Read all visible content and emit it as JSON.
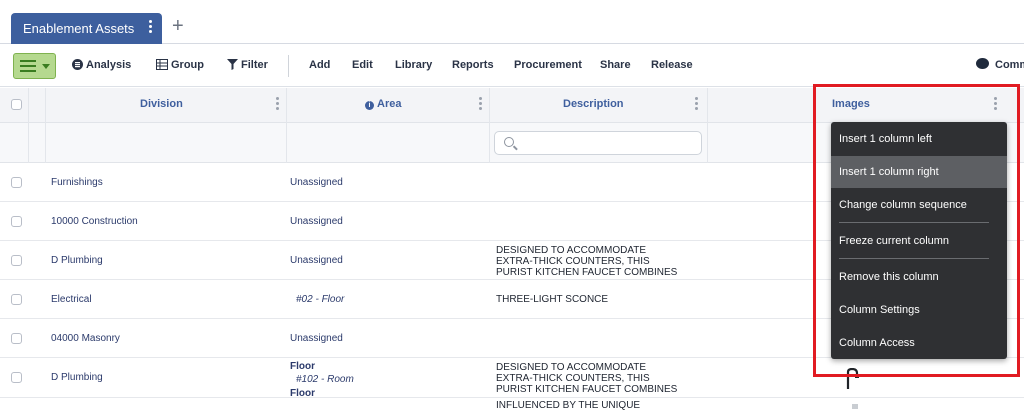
{
  "tab": {
    "label": "Enablement Assets",
    "add_symbol": "+"
  },
  "toolbar": {
    "analysis": "Analysis",
    "group": "Group",
    "filter": "Filter",
    "add": "Add",
    "edit": "Edit",
    "library": "Library",
    "reports": "Reports",
    "procurement": "Procurement",
    "share": "Share",
    "release": "Release",
    "comments": "Comm"
  },
  "columns": {
    "division": "Division",
    "area": "Area",
    "description": "Description",
    "images": "Images"
  },
  "rows": [
    {
      "division": "Furnishings",
      "area": "Unassigned",
      "desc": []
    },
    {
      "division": "10000 Construction",
      "area": "Unassigned",
      "desc": []
    },
    {
      "division": "D Plumbing",
      "area": "Unassigned",
      "desc": [
        "DESIGNED TO ACCOMMODATE",
        "EXTRA-THICK COUNTERS, THIS",
        "PURIST KITCHEN FAUCET COMBINES"
      ]
    },
    {
      "division": "Electrical",
      "area": "#02 - Floor",
      "desc": [
        "THREE-LIGHT SCONCE"
      ]
    },
    {
      "division": "04000 Masonry",
      "area": "Unassigned",
      "desc": []
    },
    {
      "division": "D Plumbing",
      "area_lines": [
        "Floor",
        "#102 - Room",
        "Floor"
      ],
      "desc": [
        "DESIGNED TO ACCOMMODATE",
        "EXTRA-THICK COUNTERS, THIS",
        "PURIST KITCHEN FAUCET COMBINES"
      ]
    },
    {
      "division": "",
      "area": "",
      "desc": [
        "INFLUENCED BY THE UNIQUE"
      ]
    }
  ],
  "context_menu": [
    "Insert 1 column left",
    "Insert 1 column right",
    "Change column sequence",
    "Freeze current column",
    "Remove this column",
    "Column Settings",
    "Column Access"
  ],
  "colors": {
    "tab": "#3d5f9e",
    "menu_bg": "#2f3033",
    "highlight": "#e11b22",
    "accent_green": "#b5d98f"
  }
}
